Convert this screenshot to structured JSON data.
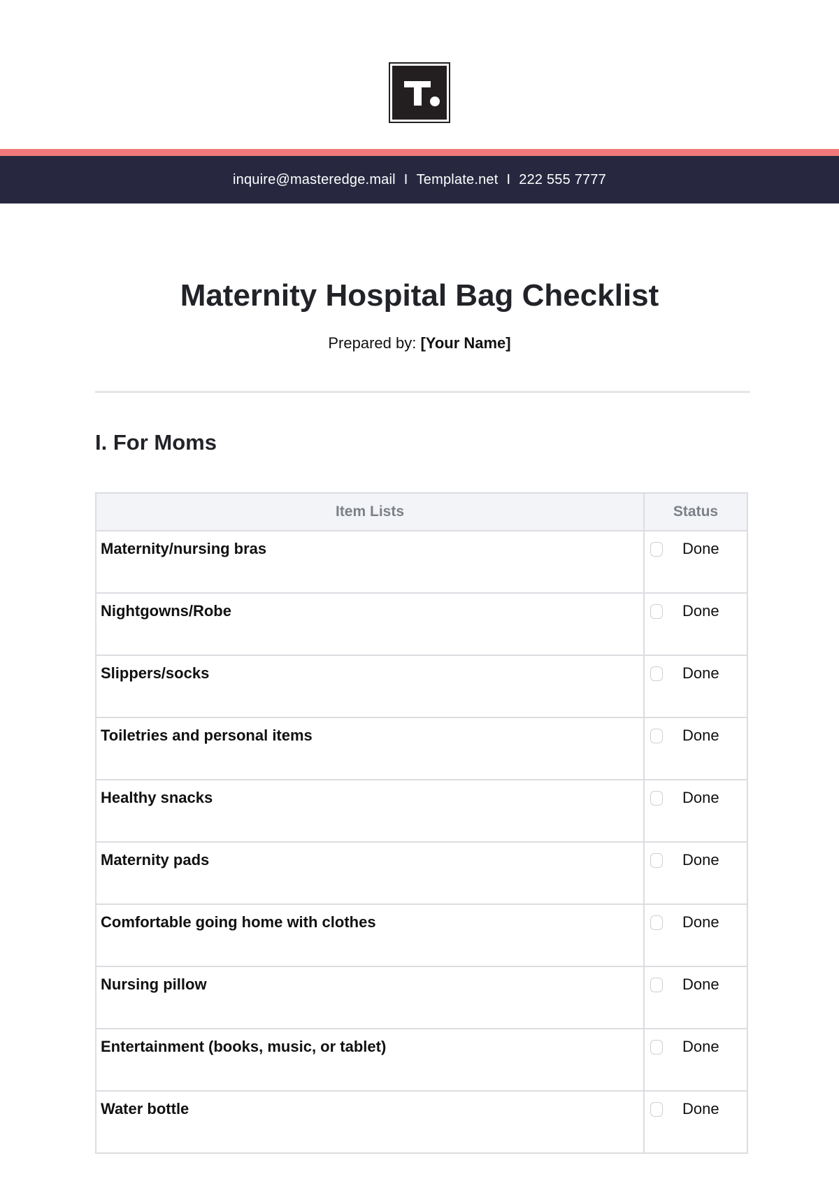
{
  "header": {
    "logo_icon": "template-t-logo-icon",
    "contact": {
      "email": "inquire@masteredge.mail",
      "website": "Template.net",
      "phone": "222 555 7777",
      "separator": "I"
    },
    "accent_color": "#f07a7a",
    "bar_color": "#272840"
  },
  "document": {
    "title": "Maternity Hospital Bag Checklist",
    "prepared_by_label": "Prepared by:",
    "prepared_by_value": "[Your Name]"
  },
  "sections": [
    {
      "heading": "I. For Moms",
      "table": {
        "columns": [
          "Item Lists",
          "Status"
        ],
        "rows": [
          {
            "item": "Maternity/nursing bras",
            "status": "Done",
            "checked": false
          },
          {
            "item": "Nightgowns/Robe",
            "status": "Done",
            "checked": false
          },
          {
            "item": "Slippers/socks",
            "status": "Done",
            "checked": false
          },
          {
            "item": "Toiletries and personal items",
            "status": "Done",
            "checked": false
          },
          {
            "item": "Healthy snacks",
            "status": "Done",
            "checked": false
          },
          {
            "item": "Maternity pads",
            "status": "Done",
            "checked": false
          },
          {
            "item": "Comfortable going home with clothes",
            "status": "Done",
            "checked": false
          },
          {
            "item": "Nursing pillow",
            "status": "Done",
            "checked": false
          },
          {
            "item": "Entertainment (books, music, or tablet)",
            "status": "Done",
            "checked": false
          },
          {
            "item": "Water bottle",
            "status": "Done",
            "checked": false
          }
        ]
      }
    }
  ]
}
